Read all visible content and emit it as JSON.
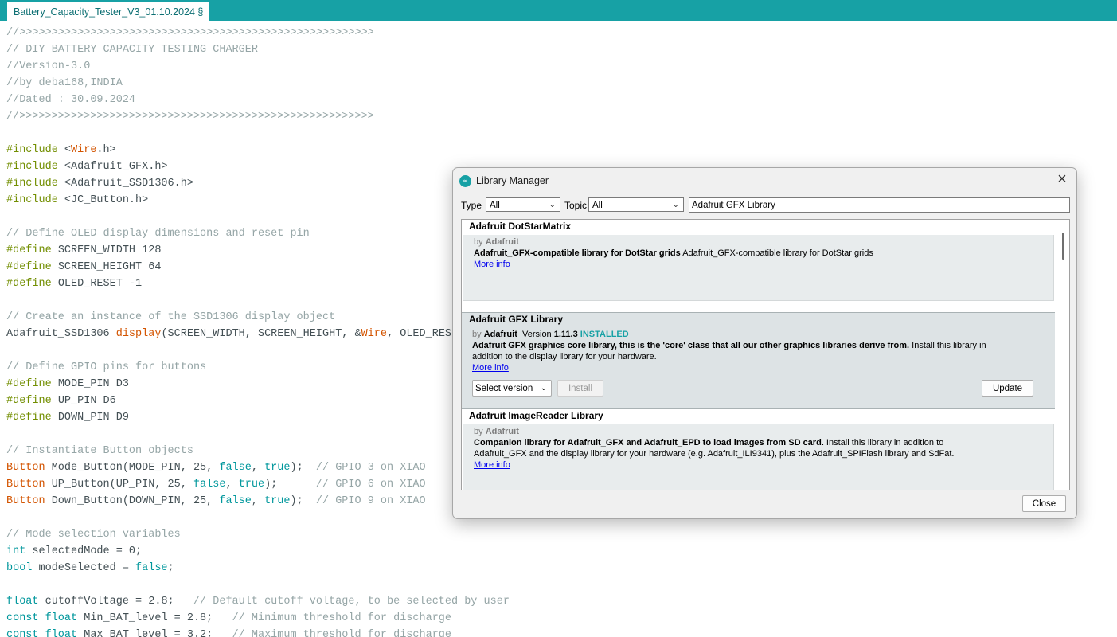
{
  "editor": {
    "tab_label": "Battery_Capacity_Tester_V3_01.10.2024 §",
    "lines": [
      [
        {
          "c": "cm",
          "t": "//>>>>>>>>>>>>>>>>>>>>>>>>>>>>>>>>>>>>>>>>>>>>>>>>>>>>>>>"
        }
      ],
      [
        {
          "c": "cm",
          "t": "// DIY BATTERY CAPACITY TESTING CHARGER"
        }
      ],
      [
        {
          "c": "cm",
          "t": "//Version-3.0"
        }
      ],
      [
        {
          "c": "cm",
          "t": "//by deba168,INDIA"
        }
      ],
      [
        {
          "c": "cm",
          "t": "//Dated : 30.09.2024"
        }
      ],
      [
        {
          "c": "cm",
          "t": "//>>>>>>>>>>>>>>>>>>>>>>>>>>>>>>>>>>>>>>>>>>>>>>>>>>>>>>>"
        }
      ],
      [],
      [
        {
          "c": "pp",
          "t": "#include"
        },
        {
          "t": " <"
        },
        {
          "c": "kw",
          "t": "Wire"
        },
        {
          "t": ".h>"
        }
      ],
      [
        {
          "c": "pp",
          "t": "#include"
        },
        {
          "t": " <Adafruit_GFX.h>"
        }
      ],
      [
        {
          "c": "pp",
          "t": "#include"
        },
        {
          "t": " <Adafruit_SSD1306.h>"
        }
      ],
      [
        {
          "c": "pp",
          "t": "#include"
        },
        {
          "t": " <JC_Button.h>"
        }
      ],
      [],
      [
        {
          "c": "cm",
          "t": "// Define OLED display dimensions and reset pin"
        }
      ],
      [
        {
          "c": "pp",
          "t": "#define"
        },
        {
          "t": " SCREEN_WIDTH 128"
        }
      ],
      [
        {
          "c": "pp",
          "t": "#define"
        },
        {
          "t": " SCREEN_HEIGHT 64"
        }
      ],
      [
        {
          "c": "pp",
          "t": "#define"
        },
        {
          "t": " OLED_RESET -1"
        }
      ],
      [],
      [
        {
          "c": "cm",
          "t": "// Create an instance of the SSD1306 display object"
        }
      ],
      [
        {
          "t": "Adafruit_SSD1306 "
        },
        {
          "c": "kw",
          "t": "display"
        },
        {
          "t": "(SCREEN_WIDTH, SCREEN_HEIGHT, &"
        },
        {
          "c": "kw",
          "t": "Wire"
        },
        {
          "t": ", OLED_RESET);"
        }
      ],
      [],
      [
        {
          "c": "cm",
          "t": "// Define GPIO pins for buttons"
        }
      ],
      [
        {
          "c": "pp",
          "t": "#define"
        },
        {
          "t": " MODE_PIN D3"
        }
      ],
      [
        {
          "c": "pp",
          "t": "#define"
        },
        {
          "t": " UP_PIN D6"
        }
      ],
      [
        {
          "c": "pp",
          "t": "#define"
        },
        {
          "t": " DOWN_PIN D9"
        }
      ],
      [],
      [
        {
          "c": "cm",
          "t": "// Instantiate Button objects"
        }
      ],
      [
        {
          "c": "kw",
          "t": "Button"
        },
        {
          "t": " Mode_Button(MODE_PIN, 25, "
        },
        {
          "c": "ty",
          "t": "false"
        },
        {
          "t": ", "
        },
        {
          "c": "ty",
          "t": "true"
        },
        {
          "t": ");  "
        },
        {
          "c": "cm",
          "t": "// GPIO 3 on XIAO"
        }
      ],
      [
        {
          "c": "kw",
          "t": "Button"
        },
        {
          "t": " UP_Button(UP_PIN, 25, "
        },
        {
          "c": "ty",
          "t": "false"
        },
        {
          "t": ", "
        },
        {
          "c": "ty",
          "t": "true"
        },
        {
          "t": ");      "
        },
        {
          "c": "cm",
          "t": "// GPIO 6 on XIAO"
        }
      ],
      [
        {
          "c": "kw",
          "t": "Button"
        },
        {
          "t": " Down_Button(DOWN_PIN, 25, "
        },
        {
          "c": "ty",
          "t": "false"
        },
        {
          "t": ", "
        },
        {
          "c": "ty",
          "t": "true"
        },
        {
          "t": ");  "
        },
        {
          "c": "cm",
          "t": "// GPIO 9 on XIAO"
        }
      ],
      [],
      [
        {
          "c": "cm",
          "t": "// Mode selection variables"
        }
      ],
      [
        {
          "c": "ty",
          "t": "int"
        },
        {
          "t": " selectedMode = 0;"
        }
      ],
      [
        {
          "c": "ty",
          "t": "bool"
        },
        {
          "t": " modeSelected = "
        },
        {
          "c": "ty",
          "t": "false"
        },
        {
          "t": ";"
        }
      ],
      [],
      [
        {
          "c": "ty",
          "t": "float"
        },
        {
          "t": " cutoffVoltage = 2.8;   "
        },
        {
          "c": "cm",
          "t": "// Default cutoff voltage, to be selected by user"
        }
      ],
      [
        {
          "c": "ty",
          "t": "const float"
        },
        {
          "t": " Min_BAT_level = 2.8;   "
        },
        {
          "c": "cm",
          "t": "// Minimum threshold for discharge"
        }
      ],
      [
        {
          "c": "ty",
          "t": "const float"
        },
        {
          "t": " Max_BAT_level = 3.2;   "
        },
        {
          "c": "cm",
          "t": "// Maximum threshold for discharge"
        }
      ]
    ]
  },
  "library_manager": {
    "title": "Library Manager",
    "logo_text": "∞",
    "type_label": "Type",
    "type_value": "All",
    "topic_label": "Topic",
    "topic_value": "All",
    "search_value": "Adafruit GFX Library",
    "close_button": "Close",
    "entries": [
      {
        "name": "Adafruit DotStarMatrix",
        "by": "by",
        "author": "Adafruit",
        "desc_bold": "Adafruit_GFX-compatible library for DotStar grids",
        "desc": "Adafruit_GFX-compatible library for DotStar grids",
        "more": "More info"
      },
      {
        "name": "Adafruit GFX Library",
        "by": "by",
        "author": "Adafruit",
        "version_label": "Version",
        "version": "1.11.3",
        "installed": "INSTALLED",
        "desc_bold": "Adafruit GFX graphics core library, this is the 'core' class that all our other graphics libraries derive from.",
        "desc_line1": "Install this library in",
        "desc_line2": "addition to the display library for your hardware.",
        "more": "More info",
        "select_version": "Select version",
        "install_button": "Install",
        "update_button": "Update"
      },
      {
        "name": "Adafruit ImageReader Library",
        "by": "by",
        "author": "Adafruit",
        "desc_bold": "Companion library for Adafruit_GFX and Adafruit_EPD to load images from SD card.",
        "desc_line1": "Install this library in addition to",
        "desc_line2": "Adafruit_GFX and the display library for your hardware (e.g. Adafruit_ILI9341), plus the Adafruit_SPIFlash library and SdFat.",
        "more": "More info"
      }
    ]
  }
}
